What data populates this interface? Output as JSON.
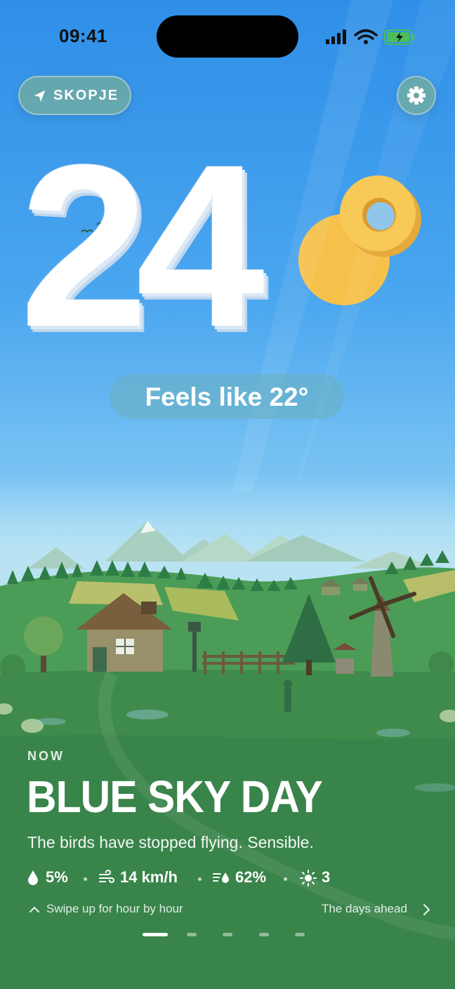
{
  "status": {
    "time": "09:41"
  },
  "location": {
    "label": "SKOPJE"
  },
  "temperature": {
    "value": "24",
    "feels_like": "Feels like 22°"
  },
  "now": {
    "label": "NOW",
    "condition": "BLUE SKY DAY",
    "description": "The birds have stopped flying. Sensible.",
    "stats": {
      "precipitation": "5%",
      "wind": "14 km/h",
      "humidity": "62%",
      "uv": "3"
    },
    "swipe_hint": "Swipe up for hour by hour",
    "days_link": "The days ahead"
  },
  "pager": {
    "pages": 5,
    "active": 0
  },
  "icons": [
    "location-arrow-icon",
    "gear-icon",
    "raindrop-icon",
    "wind-icon",
    "humidity-icon",
    "sun-icon",
    "chevron-up-icon",
    "chevron-right-icon",
    "signal-icon",
    "wifi-icon",
    "battery-icon"
  ],
  "colors": {
    "sky_top": "#2f8fe8",
    "grass": "#3f8a4a",
    "sun": "#f7c046"
  }
}
